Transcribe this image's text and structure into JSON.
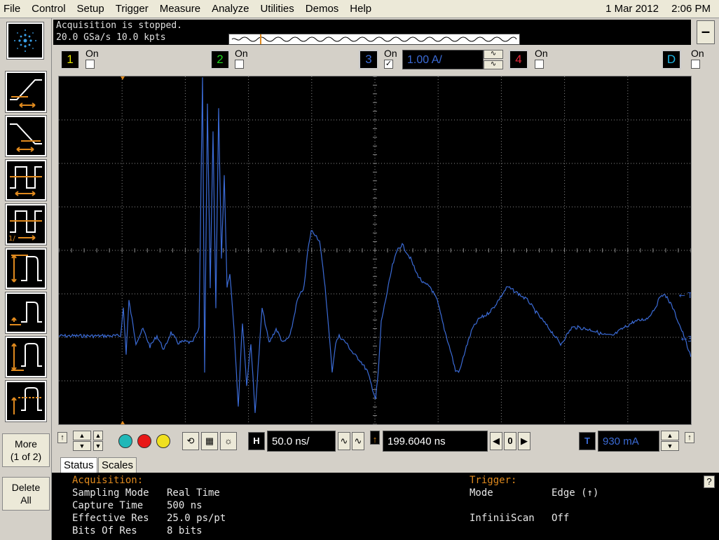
{
  "menu": [
    "File",
    "Control",
    "Setup",
    "Trigger",
    "Measure",
    "Analyze",
    "Utilities",
    "Demos",
    "Help"
  ],
  "datetime": {
    "date": "1 Mar 2012",
    "time": "2:06 PM"
  },
  "acquisition": {
    "line1": "Acquisition is stopped.",
    "line2": "20.0 GSa/s   10.0 kpts"
  },
  "minimize_label": "–",
  "channels": [
    {
      "num": "1",
      "label": "On",
      "checked": false,
      "color": "#e8e800"
    },
    {
      "num": "2",
      "label": "On",
      "checked": false,
      "color": "#1fd61f"
    },
    {
      "num": "3",
      "label": "On",
      "checked": true,
      "color": "#3b6bd6",
      "scale": "1.00 A/"
    },
    {
      "num": "4",
      "label": "On",
      "checked": false,
      "color": "#e8283c"
    },
    {
      "num": "D",
      "label": "On",
      "checked": false,
      "color": "#1fb8e8"
    }
  ],
  "left_buttons": {
    "more": "More",
    "more_page": "(1 of 2)",
    "delete": "Delete",
    "delete_all": "All"
  },
  "controls": {
    "h_label": "H",
    "timebase": "50.0 ns/",
    "delay": "199.6040 ns",
    "delay_ref": "0",
    "t_label": "T",
    "trigger_level": "930 mA"
  },
  "markers": {
    "trigger": "T",
    "ch3": "3"
  },
  "tabs": [
    "Status",
    "Scales"
  ],
  "status": {
    "acq_head": "Acquisition:",
    "trig_head": "Trigger:",
    "rows": [
      {
        "k": "Sampling Mode",
        "v": "Real Time"
      },
      {
        "k": "Capture Time",
        "v": "500 ns"
      },
      {
        "k": "Effective Res",
        "v": "25.0 ps/pt"
      },
      {
        "k": "Bits Of Res",
        "v": "8 bits"
      }
    ],
    "trig_rows": [
      {
        "k": "Mode",
        "v": "Edge (↑)"
      },
      {
        "k": "InfiniiScan",
        "v": "Off"
      }
    ]
  },
  "help_label": "?",
  "colors": {
    "trace": "#3b6bd6",
    "orange": "#e08a1e",
    "grid": "#8a8a8a"
  }
}
